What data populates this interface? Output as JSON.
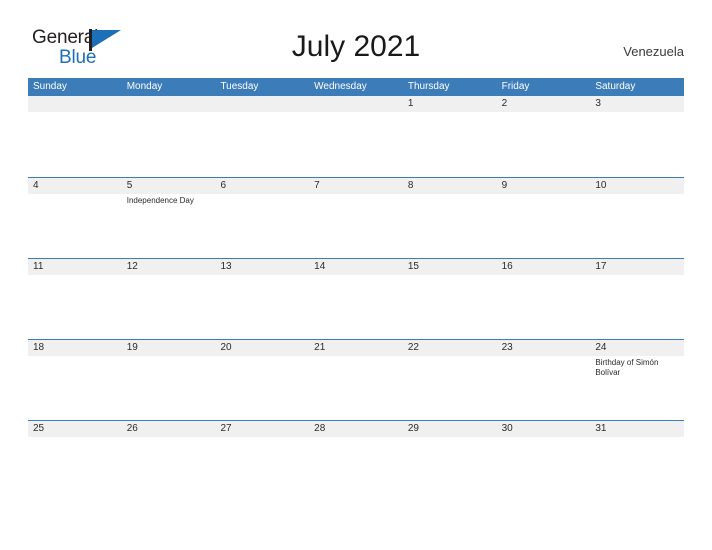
{
  "brand": {
    "name_part1": "General",
    "name_part2": "Blue",
    "flag_icon": "flag-triangle-icon",
    "colors": {
      "dark": "#231f20",
      "blue": "#1d6fb8"
    }
  },
  "header": {
    "title": "July 2021",
    "country": "Venezuela"
  },
  "calendar": {
    "accent_color": "#3c7cb8",
    "band_color": "#f0f0f0",
    "weekdays": [
      "Sunday",
      "Monday",
      "Tuesday",
      "Wednesday",
      "Thursday",
      "Friday",
      "Saturday"
    ],
    "weeks": [
      [
        {
          "date": "",
          "events": []
        },
        {
          "date": "",
          "events": []
        },
        {
          "date": "",
          "events": []
        },
        {
          "date": "",
          "events": []
        },
        {
          "date": "1",
          "events": []
        },
        {
          "date": "2",
          "events": []
        },
        {
          "date": "3",
          "events": []
        }
      ],
      [
        {
          "date": "4",
          "events": []
        },
        {
          "date": "5",
          "events": [
            "Independence Day"
          ]
        },
        {
          "date": "6",
          "events": []
        },
        {
          "date": "7",
          "events": []
        },
        {
          "date": "8",
          "events": []
        },
        {
          "date": "9",
          "events": []
        },
        {
          "date": "10",
          "events": []
        }
      ],
      [
        {
          "date": "11",
          "events": []
        },
        {
          "date": "12",
          "events": []
        },
        {
          "date": "13",
          "events": []
        },
        {
          "date": "14",
          "events": []
        },
        {
          "date": "15",
          "events": []
        },
        {
          "date": "16",
          "events": []
        },
        {
          "date": "17",
          "events": []
        }
      ],
      [
        {
          "date": "18",
          "events": []
        },
        {
          "date": "19",
          "events": []
        },
        {
          "date": "20",
          "events": []
        },
        {
          "date": "21",
          "events": []
        },
        {
          "date": "22",
          "events": []
        },
        {
          "date": "23",
          "events": []
        },
        {
          "date": "24",
          "events": [
            "Birthday of Simón Bolívar"
          ]
        }
      ],
      [
        {
          "date": "25",
          "events": []
        },
        {
          "date": "26",
          "events": []
        },
        {
          "date": "27",
          "events": []
        },
        {
          "date": "28",
          "events": []
        },
        {
          "date": "29",
          "events": []
        },
        {
          "date": "30",
          "events": []
        },
        {
          "date": "31",
          "events": []
        }
      ]
    ]
  }
}
